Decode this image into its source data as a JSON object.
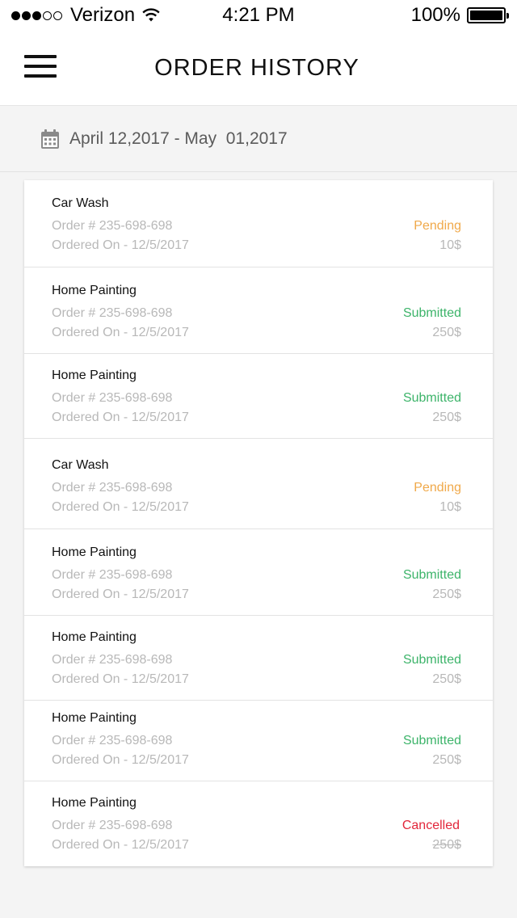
{
  "status_bar": {
    "carrier": "Verizon",
    "time": "4:21 PM",
    "battery": "100%"
  },
  "header": {
    "title": "ORDER HISTORY",
    "menu_icon": "hamburger-menu-icon"
  },
  "date_filter": {
    "icon": "calendar-icon",
    "range": "April 12,2017 - May  01,2017"
  },
  "colors": {
    "pending": "#f0a94a",
    "submitted": "#3db46a",
    "cancelled": "#e2263a",
    "muted": "#b8b8b8"
  },
  "orders": [
    {
      "service": "Car Wash",
      "order_no": "Order # 235-698-698",
      "ordered_on": "Ordered On - 12/5/2017",
      "status": "Pending",
      "price": "10$"
    },
    {
      "service": "Home Painting",
      "order_no": "Order # 235-698-698",
      "ordered_on": "Ordered On - 12/5/2017",
      "status": "Submitted",
      "price": "250$"
    },
    {
      "service": "Home Painting",
      "order_no": "Order # 235-698-698",
      "ordered_on": "Ordered On - 12/5/2017",
      "status": "Submitted",
      "price": "250$"
    },
    {
      "service": "Car Wash",
      "order_no": "Order # 235-698-698",
      "ordered_on": "Ordered On - 12/5/2017",
      "status": "Pending",
      "price": "10$"
    },
    {
      "service": "Home Painting",
      "order_no": "Order # 235-698-698",
      "ordered_on": "Ordered On - 12/5/2017",
      "status": "Submitted",
      "price": "250$"
    },
    {
      "service": "Home Painting",
      "order_no": "Order # 235-698-698",
      "ordered_on": "Ordered On - 12/5/2017",
      "status": "Submitted",
      "price": "250$"
    },
    {
      "service": "Home Painting",
      "order_no": "Order # 235-698-698",
      "ordered_on": "Ordered On - 12/5/2017",
      "status": "Submitted",
      "price": "250$"
    },
    {
      "service": "Home Painting",
      "order_no": "Order # 235-698-698",
      "ordered_on": "Ordered On - 12/5/2017",
      "status": "Cancelled",
      "price": "250$"
    }
  ]
}
